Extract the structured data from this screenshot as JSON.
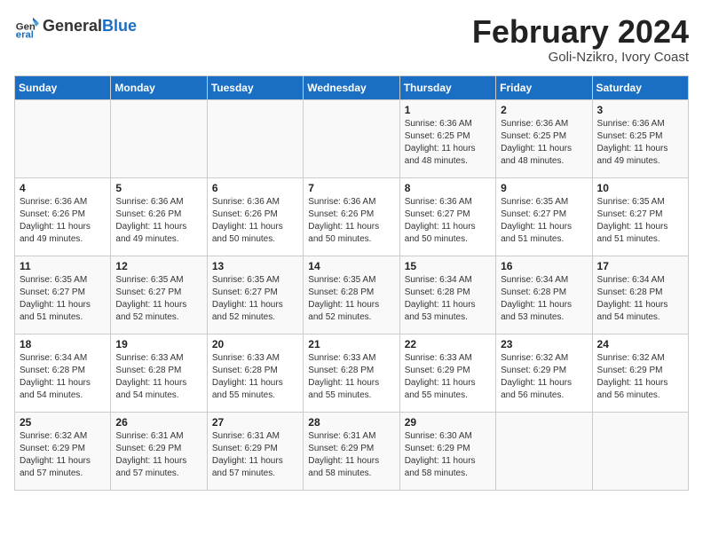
{
  "header": {
    "logo_general": "General",
    "logo_blue": "Blue",
    "month_title": "February 2024",
    "subtitle": "Goli-Nzikro, Ivory Coast"
  },
  "days_of_week": [
    "Sunday",
    "Monday",
    "Tuesday",
    "Wednesday",
    "Thursday",
    "Friday",
    "Saturday"
  ],
  "weeks": [
    [
      {
        "day": "",
        "info": ""
      },
      {
        "day": "",
        "info": ""
      },
      {
        "day": "",
        "info": ""
      },
      {
        "day": "",
        "info": ""
      },
      {
        "day": "1",
        "info": "Sunrise: 6:36 AM\nSunset: 6:25 PM\nDaylight: 11 hours and 48 minutes."
      },
      {
        "day": "2",
        "info": "Sunrise: 6:36 AM\nSunset: 6:25 PM\nDaylight: 11 hours and 48 minutes."
      },
      {
        "day": "3",
        "info": "Sunrise: 6:36 AM\nSunset: 6:25 PM\nDaylight: 11 hours and 49 minutes."
      }
    ],
    [
      {
        "day": "4",
        "info": "Sunrise: 6:36 AM\nSunset: 6:26 PM\nDaylight: 11 hours and 49 minutes."
      },
      {
        "day": "5",
        "info": "Sunrise: 6:36 AM\nSunset: 6:26 PM\nDaylight: 11 hours and 49 minutes."
      },
      {
        "day": "6",
        "info": "Sunrise: 6:36 AM\nSunset: 6:26 PM\nDaylight: 11 hours and 50 minutes."
      },
      {
        "day": "7",
        "info": "Sunrise: 6:36 AM\nSunset: 6:26 PM\nDaylight: 11 hours and 50 minutes."
      },
      {
        "day": "8",
        "info": "Sunrise: 6:36 AM\nSunset: 6:27 PM\nDaylight: 11 hours and 50 minutes."
      },
      {
        "day": "9",
        "info": "Sunrise: 6:35 AM\nSunset: 6:27 PM\nDaylight: 11 hours and 51 minutes."
      },
      {
        "day": "10",
        "info": "Sunrise: 6:35 AM\nSunset: 6:27 PM\nDaylight: 11 hours and 51 minutes."
      }
    ],
    [
      {
        "day": "11",
        "info": "Sunrise: 6:35 AM\nSunset: 6:27 PM\nDaylight: 11 hours and 51 minutes."
      },
      {
        "day": "12",
        "info": "Sunrise: 6:35 AM\nSunset: 6:27 PM\nDaylight: 11 hours and 52 minutes."
      },
      {
        "day": "13",
        "info": "Sunrise: 6:35 AM\nSunset: 6:27 PM\nDaylight: 11 hours and 52 minutes."
      },
      {
        "day": "14",
        "info": "Sunrise: 6:35 AM\nSunset: 6:28 PM\nDaylight: 11 hours and 52 minutes."
      },
      {
        "day": "15",
        "info": "Sunrise: 6:34 AM\nSunset: 6:28 PM\nDaylight: 11 hours and 53 minutes."
      },
      {
        "day": "16",
        "info": "Sunrise: 6:34 AM\nSunset: 6:28 PM\nDaylight: 11 hours and 53 minutes."
      },
      {
        "day": "17",
        "info": "Sunrise: 6:34 AM\nSunset: 6:28 PM\nDaylight: 11 hours and 54 minutes."
      }
    ],
    [
      {
        "day": "18",
        "info": "Sunrise: 6:34 AM\nSunset: 6:28 PM\nDaylight: 11 hours and 54 minutes."
      },
      {
        "day": "19",
        "info": "Sunrise: 6:33 AM\nSunset: 6:28 PM\nDaylight: 11 hours and 54 minutes."
      },
      {
        "day": "20",
        "info": "Sunrise: 6:33 AM\nSunset: 6:28 PM\nDaylight: 11 hours and 55 minutes."
      },
      {
        "day": "21",
        "info": "Sunrise: 6:33 AM\nSunset: 6:28 PM\nDaylight: 11 hours and 55 minutes."
      },
      {
        "day": "22",
        "info": "Sunrise: 6:33 AM\nSunset: 6:29 PM\nDaylight: 11 hours and 55 minutes."
      },
      {
        "day": "23",
        "info": "Sunrise: 6:32 AM\nSunset: 6:29 PM\nDaylight: 11 hours and 56 minutes."
      },
      {
        "day": "24",
        "info": "Sunrise: 6:32 AM\nSunset: 6:29 PM\nDaylight: 11 hours and 56 minutes."
      }
    ],
    [
      {
        "day": "25",
        "info": "Sunrise: 6:32 AM\nSunset: 6:29 PM\nDaylight: 11 hours and 57 minutes."
      },
      {
        "day": "26",
        "info": "Sunrise: 6:31 AM\nSunset: 6:29 PM\nDaylight: 11 hours and 57 minutes."
      },
      {
        "day": "27",
        "info": "Sunrise: 6:31 AM\nSunset: 6:29 PM\nDaylight: 11 hours and 57 minutes."
      },
      {
        "day": "28",
        "info": "Sunrise: 6:31 AM\nSunset: 6:29 PM\nDaylight: 11 hours and 58 minutes."
      },
      {
        "day": "29",
        "info": "Sunrise: 6:30 AM\nSunset: 6:29 PM\nDaylight: 11 hours and 58 minutes."
      },
      {
        "day": "",
        "info": ""
      },
      {
        "day": "",
        "info": ""
      }
    ]
  ]
}
